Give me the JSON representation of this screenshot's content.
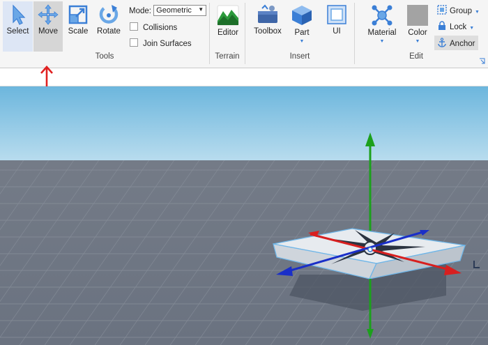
{
  "toolbar": {
    "tools": {
      "title": "Tools",
      "select_label": "Select",
      "move_label": "Move",
      "scale_label": "Scale",
      "rotate_label": "Rotate",
      "mode_label": "Mode:",
      "mode_value": "Geometric",
      "collisions_label": "Collisions",
      "join_surfaces_label": "Join Surfaces"
    },
    "terrain": {
      "title": "Terrain",
      "editor_label": "Editor"
    },
    "insert": {
      "title": "Insert",
      "toolbox_label": "Toolbox",
      "part_label": "Part",
      "ui_label": "UI"
    },
    "edit": {
      "title": "Edit",
      "material_label": "Material",
      "color_label": "Color",
      "group_label": "Group",
      "lock_label": "Lock",
      "anchor_label": "Anchor"
    }
  },
  "colors": {
    "accent": "#3b7fd6",
    "active_tool_bg": "#d6d6d6",
    "annotation_arrow": "#e02020",
    "axis_x": "#d81f1f",
    "axis_y": "#1ca01c",
    "axis_z": "#1a2fc8"
  }
}
